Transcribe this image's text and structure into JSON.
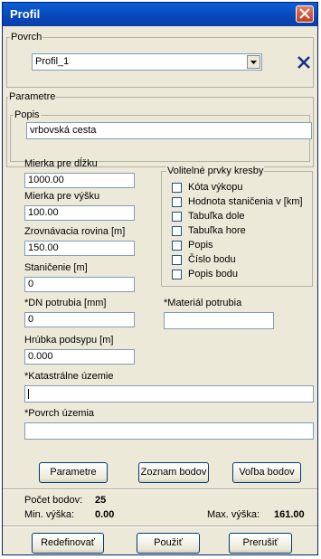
{
  "window": {
    "title": "Profil"
  },
  "povrch": {
    "group_label": "Povrch",
    "select_value": "Profil_1"
  },
  "parametre": {
    "group_label": "Parametre",
    "popis_label": "Popis",
    "popis_value": "vrbovská cesta"
  },
  "fields": {
    "mierka_dlzka_label": "Mierka pre dĺžku",
    "mierka_dlzka_value": "1000.00",
    "mierka_vyska_label": "Mierka pre výšku",
    "mierka_vyska_value": "100.00",
    "zrovnavacia_label": "Zrovnávacia rovina [m]",
    "zrovnavacia_value": "150.00",
    "stanicenie_label": "Staničenie [m]",
    "stanicenie_value": "0",
    "dn_label": "*DN potrubia [mm]",
    "dn_value": "0",
    "material_label": "*Materiál potrubia",
    "material_value": "",
    "hrubka_label": "Hrúbka podsypu [m]",
    "hrubka_value": "0.000",
    "katastralne_label": "*Katastrálne územie",
    "katastralne_value": "",
    "povrch_uzemia_label": "*Povrch územia",
    "povrch_uzemia_value": ""
  },
  "volitelne": {
    "group_label": "Volitelné prvky kresby",
    "items": [
      "Kóta výkopu",
      "Hodnota staničenia v [km]",
      "Tabuľka dole",
      "Tabuľka hore",
      "Popis",
      "Číslo bodu",
      "Popis bodu"
    ]
  },
  "buttons": {
    "parametre": "Parametre",
    "zoznam": "Zoznam bodov",
    "volba": "Voľba bodov",
    "redefinovat": "Redefinovať",
    "pouzit": "Použiť",
    "prerusit": "Prerušiť"
  },
  "stats": {
    "pocet_label": "Počet bodov:",
    "pocet_value": "25",
    "min_label": "Min. výška:",
    "min_value": "0.00",
    "max_label": "Max. výška:",
    "max_value": "161.00"
  }
}
